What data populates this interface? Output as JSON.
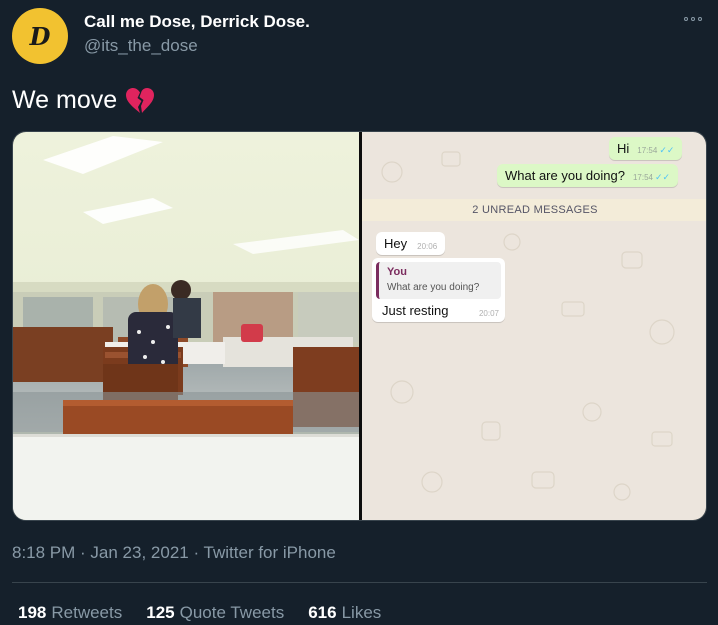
{
  "tweet": {
    "display_name": "Call me Dose, Derrick Dose.",
    "handle": "@its_the_dose",
    "avatar_glyph": "D",
    "text": "We move",
    "emoji": "broken-heart-icon",
    "timestamp": "8:18 PM · Jan 23, 2021",
    "separator": " · ",
    "source": "Twitter for iPhone"
  },
  "chat": {
    "outgoing": [
      {
        "text": "Hi",
        "time": "17:54"
      },
      {
        "text": "What are you doing?",
        "time": "17:54"
      }
    ],
    "unread_label": "2 UNREAD MESSAGES",
    "incoming_1": {
      "text": "Hey",
      "time": "20:06"
    },
    "reply": {
      "quote_sender": "You",
      "quote_text": "What are you doing?",
      "text": "Just resting",
      "time": "20:07"
    }
  },
  "stats": {
    "retweets": {
      "count": "198",
      "label": "Retweets"
    },
    "quotes": {
      "count": "125",
      "label": "Quote Tweets"
    },
    "likes": {
      "count": "616",
      "label": "Likes"
    }
  },
  "colors": {
    "background": "#15202b",
    "secondary_text": "#8899a6",
    "avatar": "#f2c230",
    "heart": "#e0245e",
    "whatsapp_outgoing": "#dcf8c6"
  }
}
